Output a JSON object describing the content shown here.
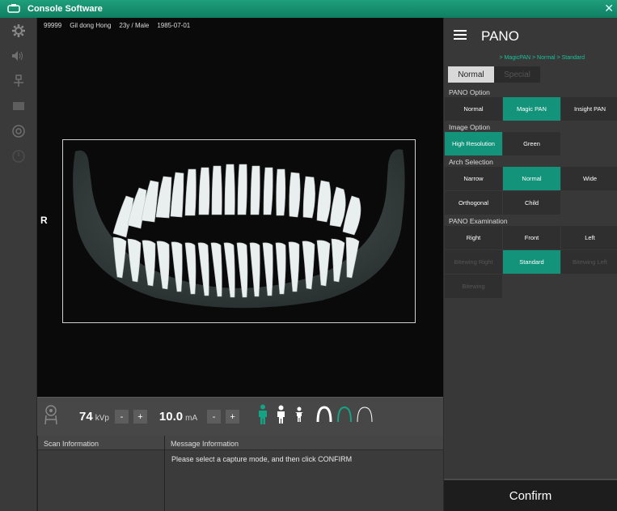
{
  "titlebar": {
    "title": "Console Software",
    "close": "✕"
  },
  "patient": {
    "id": "99999",
    "name": "Gil dong Hong",
    "age_sex": "23y / Male",
    "dob": "1985-07-01"
  },
  "viewer": {
    "side_marker": "R"
  },
  "controls": {
    "kvp_value": "74",
    "kvp_unit": "kVp",
    "ma_value": "10.0",
    "ma_unit": "mA",
    "minus": "-",
    "plus": "+"
  },
  "scan_info": {
    "header": "Scan Information"
  },
  "message_info": {
    "header": "Message Information",
    "text": "Please select a capture mode, and then click CONFIRM"
  },
  "panel": {
    "title": "PANO",
    "breadcrumb": "> MagicPAN > Normal > Standard",
    "tabs": [
      "Normal",
      "Special"
    ],
    "sections": [
      {
        "label": "PANO Option",
        "options": [
          "Normal",
          "Magic PAN",
          "Insight PAN"
        ]
      },
      {
        "label": "Image Option",
        "options": [
          "High Resolution",
          "Green"
        ]
      },
      {
        "label": "Arch Selection",
        "options": [
          "Narrow",
          "Normal",
          "Wide",
          "Orthogonal",
          "Child"
        ]
      },
      {
        "label": "PANO Examination",
        "options": [
          "Right",
          "Front",
          "Left",
          "Bitewing Right",
          "Standard",
          "Bitewing Left",
          "Bitewing"
        ]
      }
    ],
    "confirm": "Confirm"
  },
  "colors": {
    "accent": "#13937a",
    "titlebar": "#11886a"
  }
}
